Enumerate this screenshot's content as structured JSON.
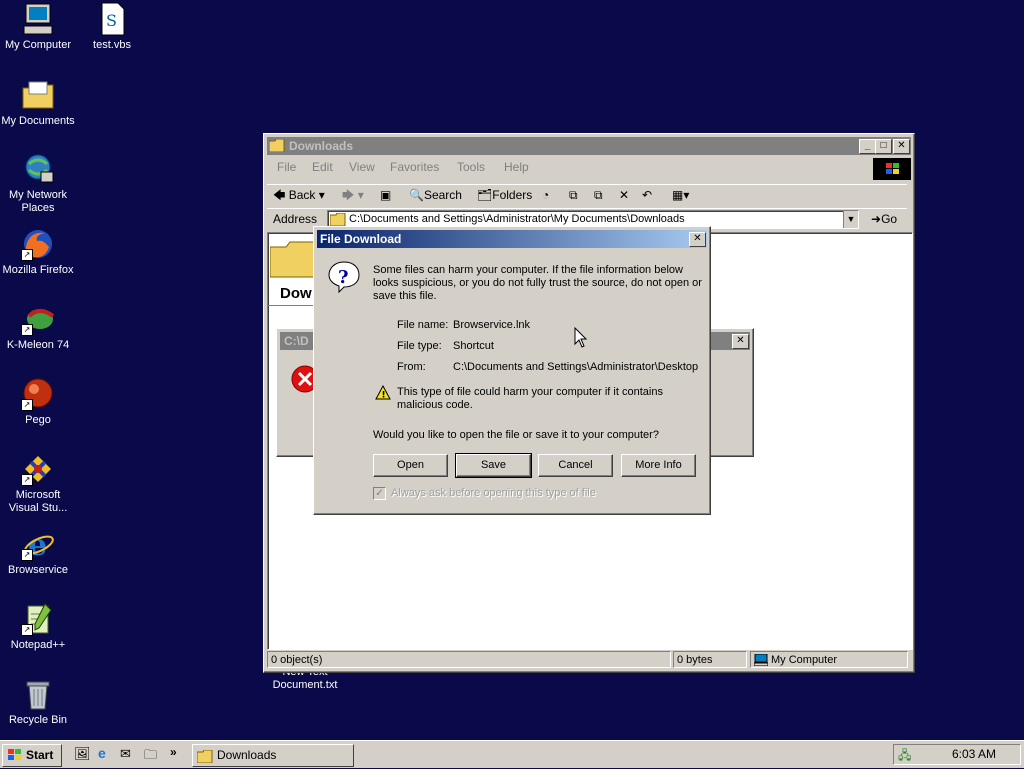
{
  "desktop": {
    "icons": [
      {
        "label": "My Computer"
      },
      {
        "label": "test.vbs"
      },
      {
        "label": "My Documents"
      },
      {
        "label": "My Network Places"
      },
      {
        "label": "Mozilla Firefox"
      },
      {
        "label": "K-Meleon 74"
      },
      {
        "label": "Pego"
      },
      {
        "label": "Microsoft Visual Stu..."
      },
      {
        "label": "Browservice"
      },
      {
        "label": "Notepad++"
      },
      {
        "label": "Recycle Bin"
      }
    ],
    "partial_icon_label": "New Text Document.txt"
  },
  "explorer": {
    "title": "Downloads",
    "menu": [
      "File",
      "Edit",
      "View",
      "Favorites",
      "Tools",
      "Help"
    ],
    "toolbar": {
      "back": "Back",
      "search": "Search",
      "folders": "Folders"
    },
    "address_label": "Address",
    "address_value": "C:\\Documents and Settings\\Administrator\\My Documents\\Downloads",
    "go_label": "Go",
    "folder_heading_partial": "Dow",
    "status": {
      "objects": "0 object(s)",
      "size": "0 bytes",
      "zone": "My Computer"
    }
  },
  "error_dialog": {
    "title_partial": "C:\\D"
  },
  "file_download": {
    "title": "File Download",
    "warning_text": "Some files can harm your computer. If the file information below looks suspicious, or you do not fully trust the source, do not open or save this file.",
    "fields": [
      {
        "label": "File name:",
        "value": "Browservice.lnk"
      },
      {
        "label": "File type:",
        "value": "Shortcut"
      },
      {
        "label": "From:",
        "value": "C:\\Documents and Settings\\Administrator\\Desktop"
      }
    ],
    "caution_text": "This type of file could harm your computer if it contains malicious code.",
    "question": "Would you like to open the file or save it to your computer?",
    "buttons": {
      "open": "Open",
      "save": "Save",
      "cancel": "Cancel",
      "more": "More Info"
    },
    "checkbox_label": "Always ask before opening this type of file",
    "checkbox_checked": true
  },
  "taskbar": {
    "start_label": "Start",
    "task_label": "Downloads",
    "clock": "6:03 AM"
  },
  "colors": {
    "desktop": "#0a0a4a",
    "title_active": "#0a246a",
    "face": "#d4d0c8"
  }
}
